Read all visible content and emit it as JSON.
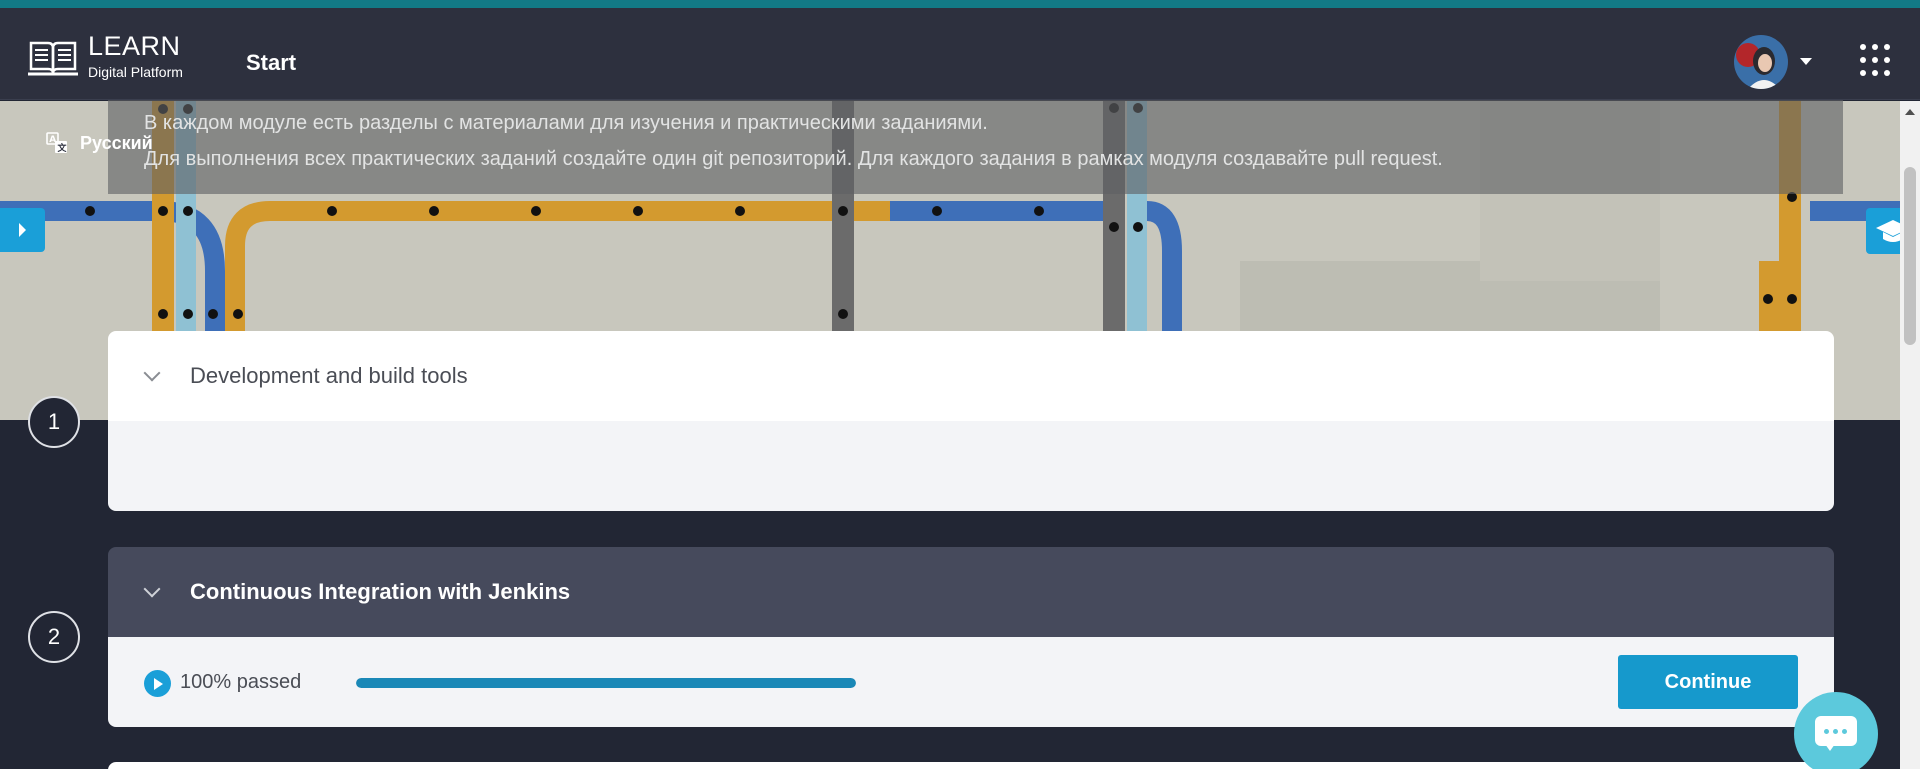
{
  "header": {
    "logo_title": "LEARN",
    "logo_subtitle": "Digital Platform",
    "nav_start": "Start"
  },
  "language": {
    "label": "Русский"
  },
  "description": {
    "line1": "В каждом модуле есть разделы с материалами для изучения и практическими заданиями.",
    "line2": "Для выполнения всех практических заданий создайте один git репозиторий. Для каждого задания в рамках модуля создавайте pull request."
  },
  "modules": [
    {
      "number": "1",
      "title": "Development and build tools"
    },
    {
      "number": "2",
      "title": "Continuous Integration with Jenkins",
      "progress_text": "100% passed",
      "progress": 1.0,
      "action": "Continue"
    }
  ],
  "icons": {
    "logo": "book-icon",
    "language": "translate-icon",
    "apps": "grid-menu-icon",
    "learn": "graduation-cap-icon",
    "chat": "chat-icon"
  },
  "colors": {
    "accent": "#1a9fd8",
    "header_bg": "#2d303e",
    "page_bg": "#222634",
    "active_card_header": "#464a5c",
    "progress_fill": "#1a88b7",
    "chat": "#5cc9dc"
  }
}
